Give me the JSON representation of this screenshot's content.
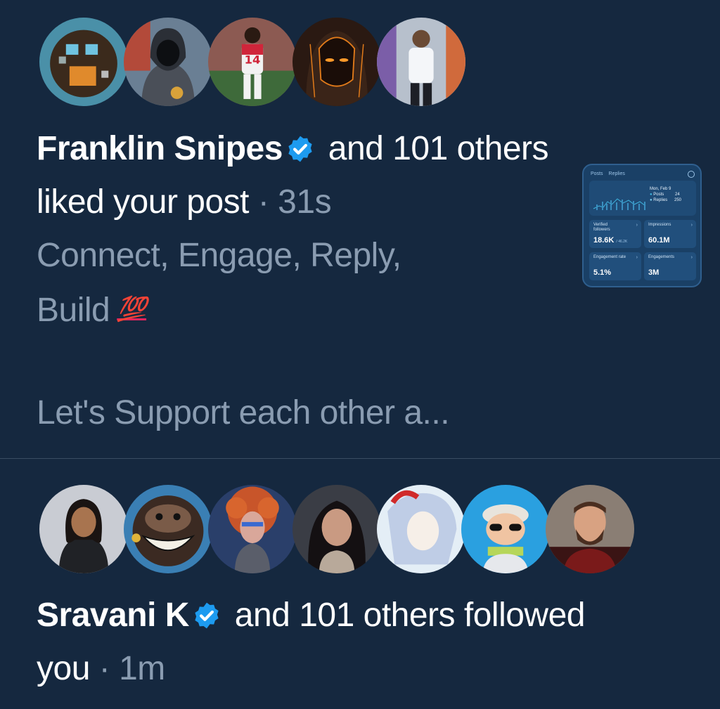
{
  "notifications": [
    {
      "type": "like",
      "actor_name": "Franklin Snipes",
      "verified": true,
      "action_text": "and 101 others liked your post",
      "separator": "·",
      "time": "31s",
      "preview_line1": "Connect, Engage, Reply,",
      "preview_line2": "Build",
      "emoji": "💯",
      "preview_truncated": "Let's Support each other a...",
      "avatars": [
        "pixel-art-avatar",
        "hooded-figure-avatar",
        "soccer-player-avatar",
        "dark-portrait-avatar",
        "man-standing-avatar"
      ],
      "attachment": {
        "tabs": [
          "Posts",
          "Replies"
        ],
        "tooltip_date": "Mon, Feb 9",
        "tooltip_posts_label": "Posts",
        "tooltip_posts_value": "24",
        "tooltip_replies_label": "Replies",
        "tooltip_replies_value": "250",
        "stats": [
          {
            "label": "Verified followers",
            "value": "18.6K",
            "sub": "/ 46.2K"
          },
          {
            "label": "Impressions",
            "value": "60.1M",
            "sub": ""
          },
          {
            "label": "Engagement rate",
            "value": "5.1%",
            "sub": ""
          },
          {
            "label": "Engagements",
            "value": "3M",
            "sub": ""
          }
        ]
      }
    },
    {
      "type": "follow",
      "actor_name": "Sravani K",
      "verified": true,
      "action_text": "and 101 others followed",
      "action_text_2": "you",
      "separator": "·",
      "time": "1m",
      "avatars": [
        "woman-avatar",
        "ape-avatar",
        "redhead-art-avatar",
        "woman-portrait-avatar",
        "anime-avatar",
        "3d-character-avatar",
        "bearded-man-avatar"
      ]
    }
  ],
  "colors": {
    "background": "#15283f",
    "secondary_text": "#8a9cb1",
    "verified_blue": "#1d9bf0",
    "divider": "#3a4d63"
  }
}
